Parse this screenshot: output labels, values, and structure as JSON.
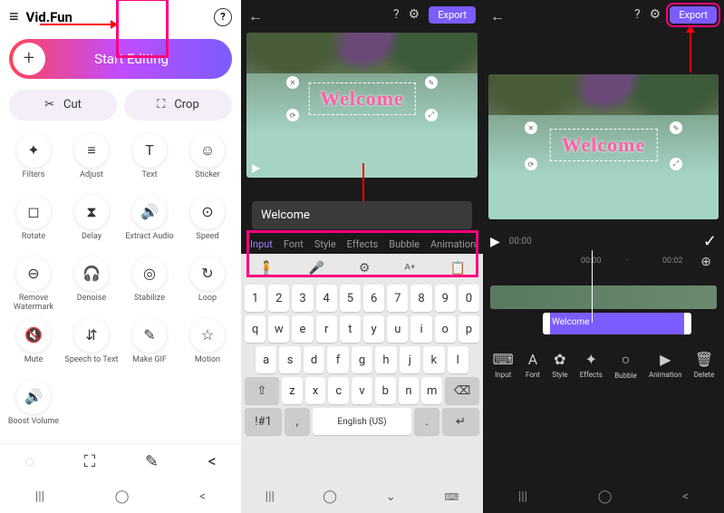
{
  "app": {
    "name": "Vid.Fun",
    "start": "Start Editing"
  },
  "cutcrop": {
    "cut": "Cut",
    "crop": "Crop"
  },
  "tools": [
    {
      "label": "Filters",
      "icon": "✦"
    },
    {
      "label": "Adjust",
      "icon": "≡"
    },
    {
      "label": "Text",
      "icon": "T"
    },
    {
      "label": "Sticker",
      "icon": "☺"
    },
    {
      "label": "Rotate",
      "icon": "◻"
    },
    {
      "label": "Delay",
      "icon": "⧗"
    },
    {
      "label": "Extract Audio",
      "icon": "🔊"
    },
    {
      "label": "Speed",
      "icon": "⊙"
    },
    {
      "label": "Remove Watermark",
      "icon": "⊖"
    },
    {
      "label": "Denoise",
      "icon": "🎧"
    },
    {
      "label": "Stabilize",
      "icon": "◎"
    },
    {
      "label": "Loop",
      "icon": "↻"
    },
    {
      "label": "Mute",
      "icon": "🔇"
    },
    {
      "label": "Speech to Text",
      "icon": "⇵"
    },
    {
      "label": "Make GIF",
      "icon": "✎"
    },
    {
      "label": "Motion",
      "icon": "☆"
    },
    {
      "label": "Boost Volume",
      "icon": "🔊"
    }
  ],
  "export": "Export",
  "preview_text": "Welcome",
  "text_input": "Welcome",
  "text_tabs": [
    "Input",
    "Font",
    "Style",
    "Effects",
    "Bubble",
    "Animation"
  ],
  "kb": {
    "nums": [
      "1",
      "2",
      "3",
      "4",
      "5",
      "6",
      "7",
      "8",
      "9",
      "0"
    ],
    "r1": [
      "q",
      "w",
      "e",
      "r",
      "t",
      "y",
      "u",
      "i",
      "o",
      "p"
    ],
    "r2": [
      "a",
      "s",
      "d",
      "f",
      "g",
      "h",
      "j",
      "k",
      "l"
    ],
    "r3": [
      "z",
      "x",
      "c",
      "v",
      "b",
      "n",
      "m"
    ],
    "shift": "⇧",
    "bksp": "⌫",
    "sym": "!#1",
    "lang": "English (US)",
    "comma": ",",
    "period": "."
  },
  "timeline": {
    "t0": "00:00",
    "t1": "00:00",
    "t2": "00:02",
    "clip": "Welcome"
  },
  "btm_tools": [
    {
      "l": "Input",
      "i": "⌨"
    },
    {
      "l": "Font",
      "i": "A"
    },
    {
      "l": "Style",
      "i": "✿"
    },
    {
      "l": "Effects",
      "i": "✦"
    },
    {
      "l": "Bubble",
      "i": "○"
    },
    {
      "l": "Animation",
      "i": "▶"
    },
    {
      "l": "Delete",
      "i": "🗑"
    }
  ]
}
